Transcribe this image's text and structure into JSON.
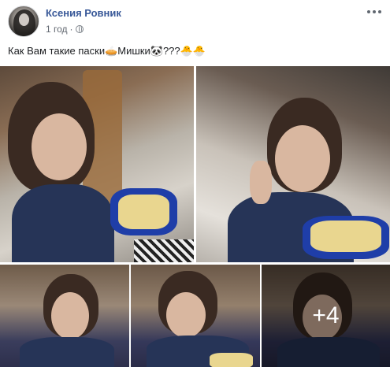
{
  "post": {
    "author_name": "Ксения Ровник",
    "timestamp": "1 год",
    "separator": "·",
    "text": "Как Вам такие паски🥧Мишки🐼???🐣🐣",
    "more_photos_label": "+4"
  },
  "icons": {
    "privacy": "globe-icon",
    "options": "more-options-icon"
  },
  "colors": {
    "author_link": "#385898",
    "meta_text": "#616770",
    "body_text": "#1c1e21"
  }
}
